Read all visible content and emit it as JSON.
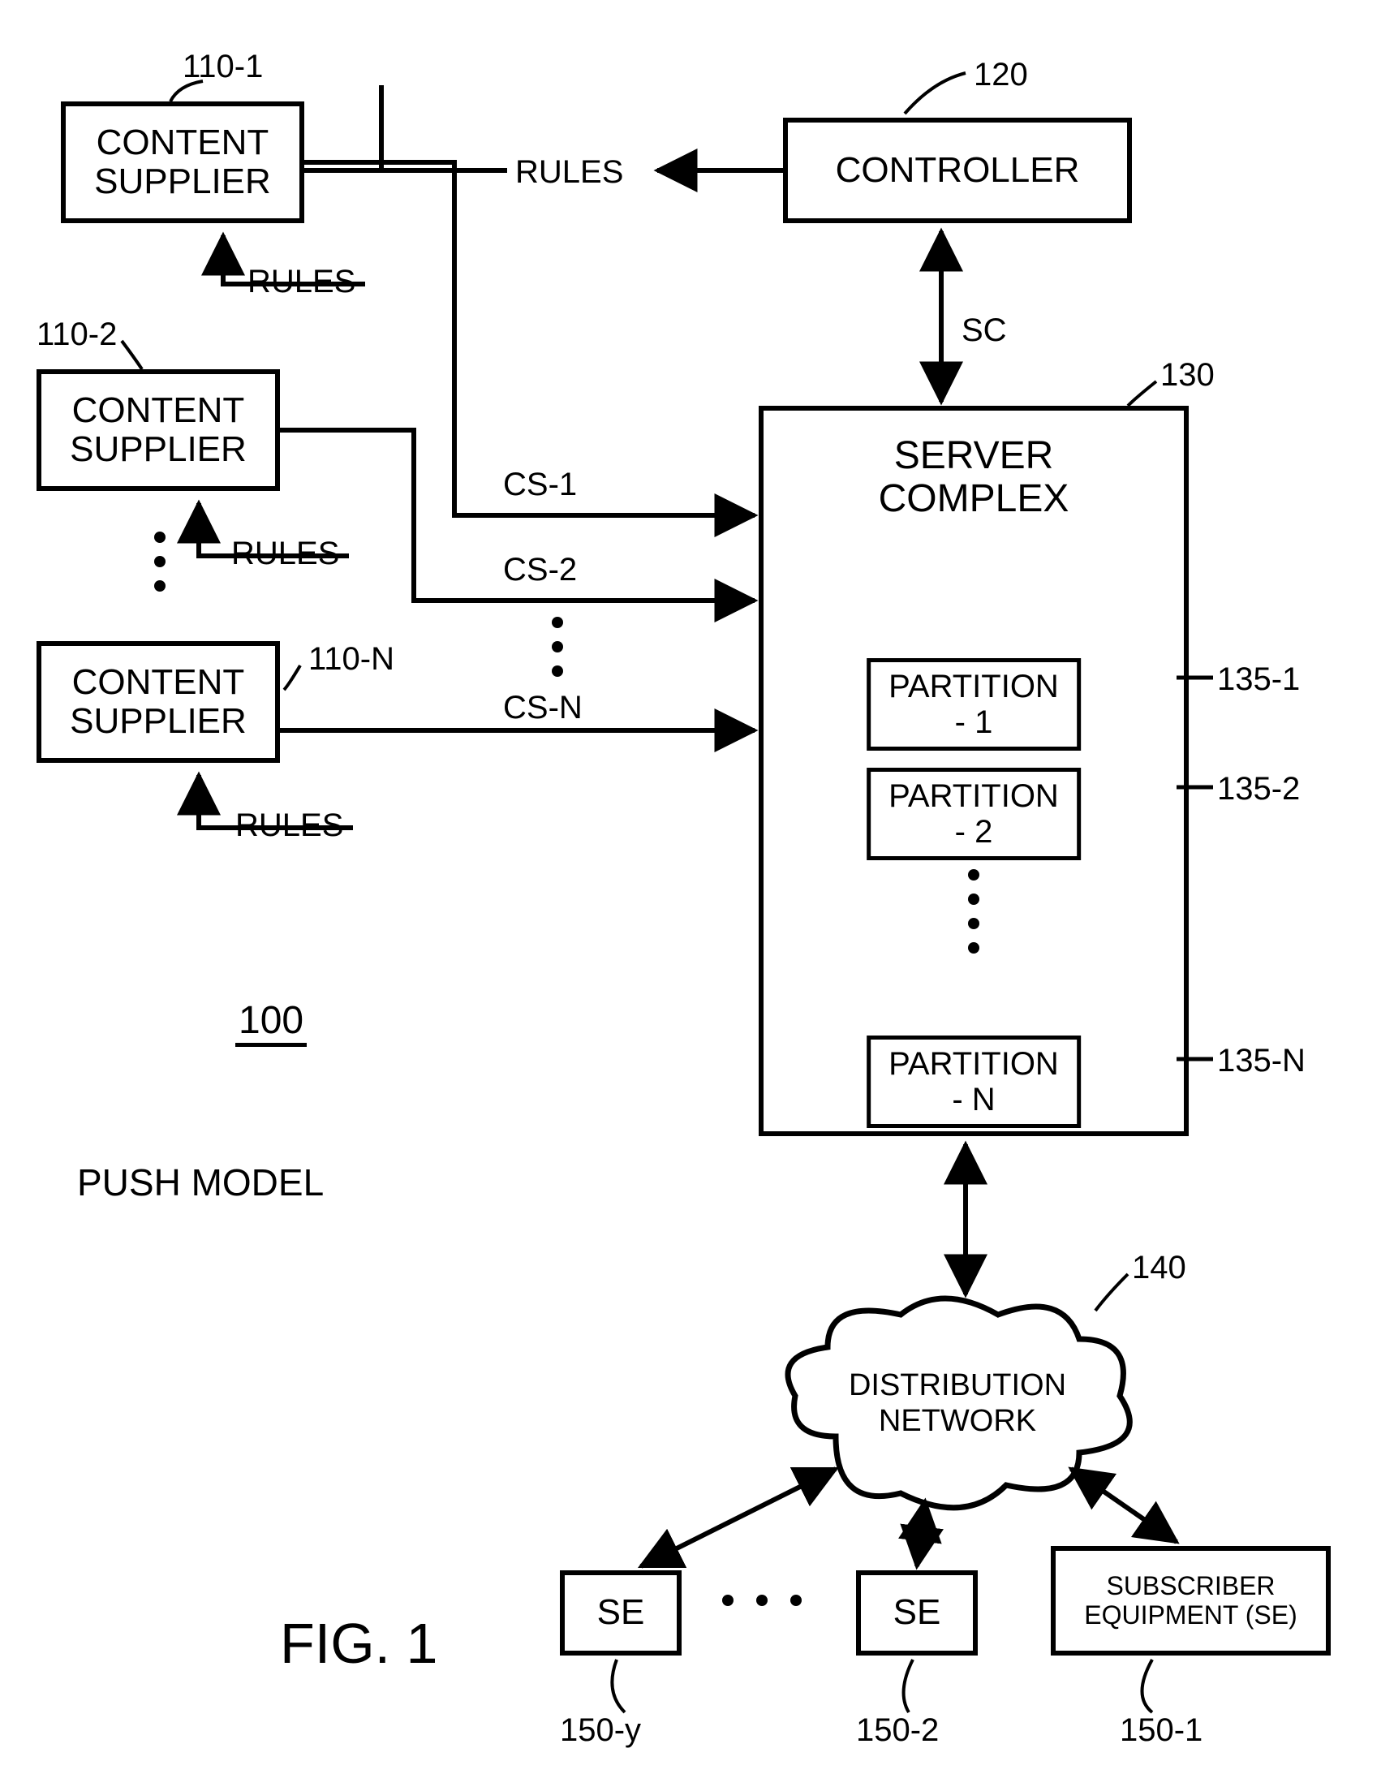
{
  "figure": {
    "number": "100",
    "model": "PUSH MODEL",
    "caption": "FIG. 1"
  },
  "suppliers": {
    "label": "CONTENT\nSUPPLIER",
    "rules": "RULES",
    "ids": {
      "s1": "110-1",
      "s2": "110-2",
      "sn": "110-N"
    }
  },
  "controller": {
    "label": "CONTROLLER",
    "id": "120",
    "sc": "SC"
  },
  "server": {
    "title": "SERVER\nCOMPLEX",
    "id": "130",
    "cs": {
      "c1": "CS-1",
      "c2": "CS-2",
      "cn": "CS-N"
    },
    "partitions": {
      "p1": "PARTITION - 1",
      "p2": "PARTITION - 2",
      "pn": "PARTITION - N",
      "id1": "135-1",
      "id2": "135-2",
      "idn": "135-N"
    }
  },
  "network": {
    "label": "DISTRIBUTION\nNETWORK",
    "id": "140"
  },
  "subscribers": {
    "se_short": "SE",
    "se_long": "SUBSCRIBER\nEQUIPMENT (SE)",
    "ids": {
      "y": "150-y",
      "s2": "150-2",
      "s1": "150-1"
    }
  }
}
